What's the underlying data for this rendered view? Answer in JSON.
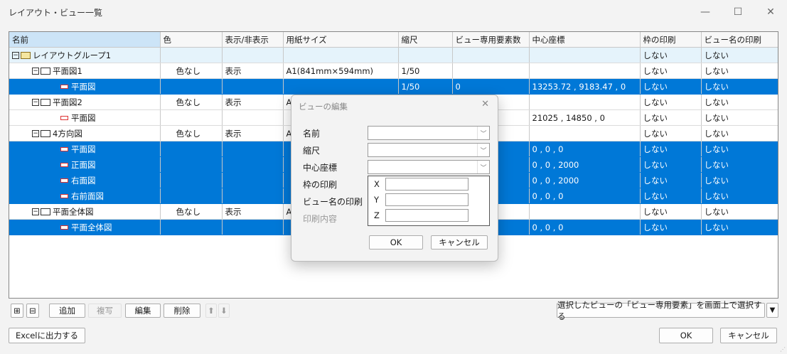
{
  "window": {
    "title": "レイアウト・ビュー一覧",
    "minimize": "—",
    "maximize": "☐",
    "close": "✕"
  },
  "table": {
    "headers": [
      "名前",
      "色",
      "表示/非表示",
      "用紙サイズ",
      "縮尺",
      "ビュー専用要素数",
      "中心座標",
      "枠の印刷",
      "ビュー名の印刷"
    ],
    "rows": [
      {
        "type": "group",
        "level": 0,
        "name": "レイアウトグループ1",
        "color": "",
        "visible": "",
        "paper": "",
        "scale": "",
        "count": "",
        "center": "",
        "frame": "しない",
        "viewname": "しない"
      },
      {
        "type": "layout",
        "level": 1,
        "name": "平面図1",
        "color": "色なし",
        "visible": "表示",
        "paper": "A1(841mm×594mm)",
        "scale": "1/50",
        "count": "",
        "center": "",
        "frame": "しない",
        "viewname": "しない"
      },
      {
        "type": "view",
        "level": 2,
        "selected": true,
        "name": "平面図",
        "color": "",
        "visible": "",
        "paper": "",
        "scale": "1/50",
        "count": "0",
        "center": "13253.72 , 9183.47 , 0",
        "frame": "しない",
        "viewname": "しない"
      },
      {
        "type": "layout",
        "level": 1,
        "name": "平面図2",
        "color": "色なし",
        "visible": "表示",
        "paper": "A",
        "scale": "",
        "count": "",
        "center": "",
        "frame": "しない",
        "viewname": "しない"
      },
      {
        "type": "view",
        "level": 2,
        "selected": false,
        "name": "平面図",
        "color": "",
        "visible": "",
        "paper": "",
        "scale": "",
        "count": "",
        "center": "21025 , 14850 , 0",
        "frame": "しない",
        "viewname": "しない"
      },
      {
        "type": "layout",
        "level": 1,
        "name": "4方向図",
        "color": "色なし",
        "visible": "表示",
        "paper": "A",
        "scale": "",
        "count": "",
        "center": "",
        "frame": "しない",
        "viewname": "しない"
      },
      {
        "type": "view",
        "level": 2,
        "selected": true,
        "name": "平面図",
        "color": "",
        "visible": "",
        "paper": "",
        "scale": "",
        "count": "",
        "center": "0 , 0 , 0",
        "frame": "しない",
        "viewname": "しない"
      },
      {
        "type": "view",
        "level": 2,
        "selected": true,
        "name": "正面図",
        "color": "",
        "visible": "",
        "paper": "",
        "scale": "",
        "count": "",
        "center": "0 , 0 , 2000",
        "frame": "しない",
        "viewname": "しない"
      },
      {
        "type": "view",
        "level": 2,
        "selected": true,
        "name": "右面図",
        "color": "",
        "visible": "",
        "paper": "",
        "scale": "",
        "count": "",
        "center": "0 , 0 , 2000",
        "frame": "しない",
        "viewname": "しない"
      },
      {
        "type": "view",
        "level": 2,
        "selected": true,
        "name": "右前面図",
        "color": "",
        "visible": "",
        "paper": "",
        "scale": "",
        "count": "",
        "center": "0 , 0 , 0",
        "frame": "しない",
        "viewname": "しない"
      },
      {
        "type": "layout",
        "level": 1,
        "name": "平面全体図",
        "color": "色なし",
        "visible": "表示",
        "paper": "A",
        "scale": "",
        "count": "",
        "center": "",
        "frame": "しない",
        "viewname": "しない"
      },
      {
        "type": "view",
        "level": 2,
        "selected": true,
        "name": "平面全体図",
        "color": "",
        "visible": "",
        "paper": "",
        "scale": "",
        "count": "",
        "center": "0 , 0 , 0",
        "frame": "しない",
        "viewname": "しない"
      }
    ]
  },
  "toolbar": {
    "expand": "⊞",
    "collapse": "⊟",
    "add": "追加",
    "copy": "複写",
    "edit": "編集",
    "delete": "削除",
    "up": "⬆",
    "down": "⬇",
    "select_view_elements": "選択したビューの「ビュー専用要素」を画面上で選択する",
    "dropdown_arrow": "▼"
  },
  "footer": {
    "excel": "Excelに出力する",
    "ok": "OK",
    "cancel": "キャンセル"
  },
  "dialog": {
    "title": "ビューの編集",
    "close": "✕",
    "name_label": "名前",
    "scale_label": "縮尺",
    "center_label": "中心座標",
    "frame_label": "枠の印刷",
    "viewname_label": "ビュー名の印刷",
    "print_content_label": "印刷内容",
    "x_label": "X",
    "y_label": "Y",
    "z_label": "Z",
    "combo_arrow": "﹀",
    "ok": "OK",
    "cancel": "キャンセル"
  },
  "colors": {
    "selection": "#0078d7",
    "group_row": "#e5f3fb",
    "header_selected": "#cce4f7",
    "view_icon": "#dd3333"
  }
}
